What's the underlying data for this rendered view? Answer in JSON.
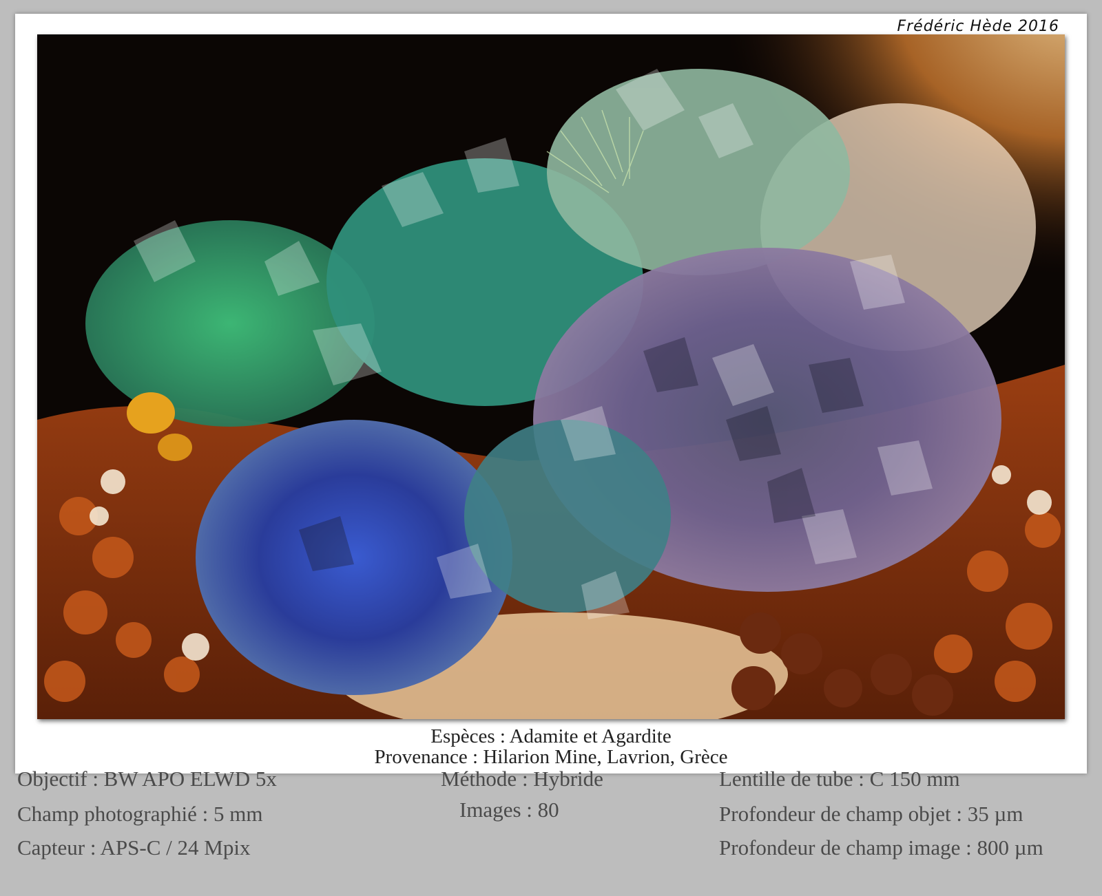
{
  "credit": "Frédéric Hède 2016",
  "caption": {
    "species": "Espèces : Adamite et Agardite",
    "provenance": "Provenance : Hilarion Mine, Lavrion, Grèce"
  },
  "details": {
    "objectif": "Objectif : BW APO ELWD 5x",
    "champ": "Champ photographié : 5 mm",
    "capteur": "Capteur : APS-C / 24 Mpix",
    "methode": "Méthode : Hybride",
    "images": "Images : 80",
    "lentille": "Lentille de tube : C 150 mm",
    "profondeur_objet": "Profondeur de champ objet : 35 µm",
    "profondeur_image": "Profondeur de champ image : 800 µm"
  },
  "colors": {
    "frame": "#bdbdbd",
    "card": "#ffffff",
    "meta_text": "#4a4a4a"
  }
}
